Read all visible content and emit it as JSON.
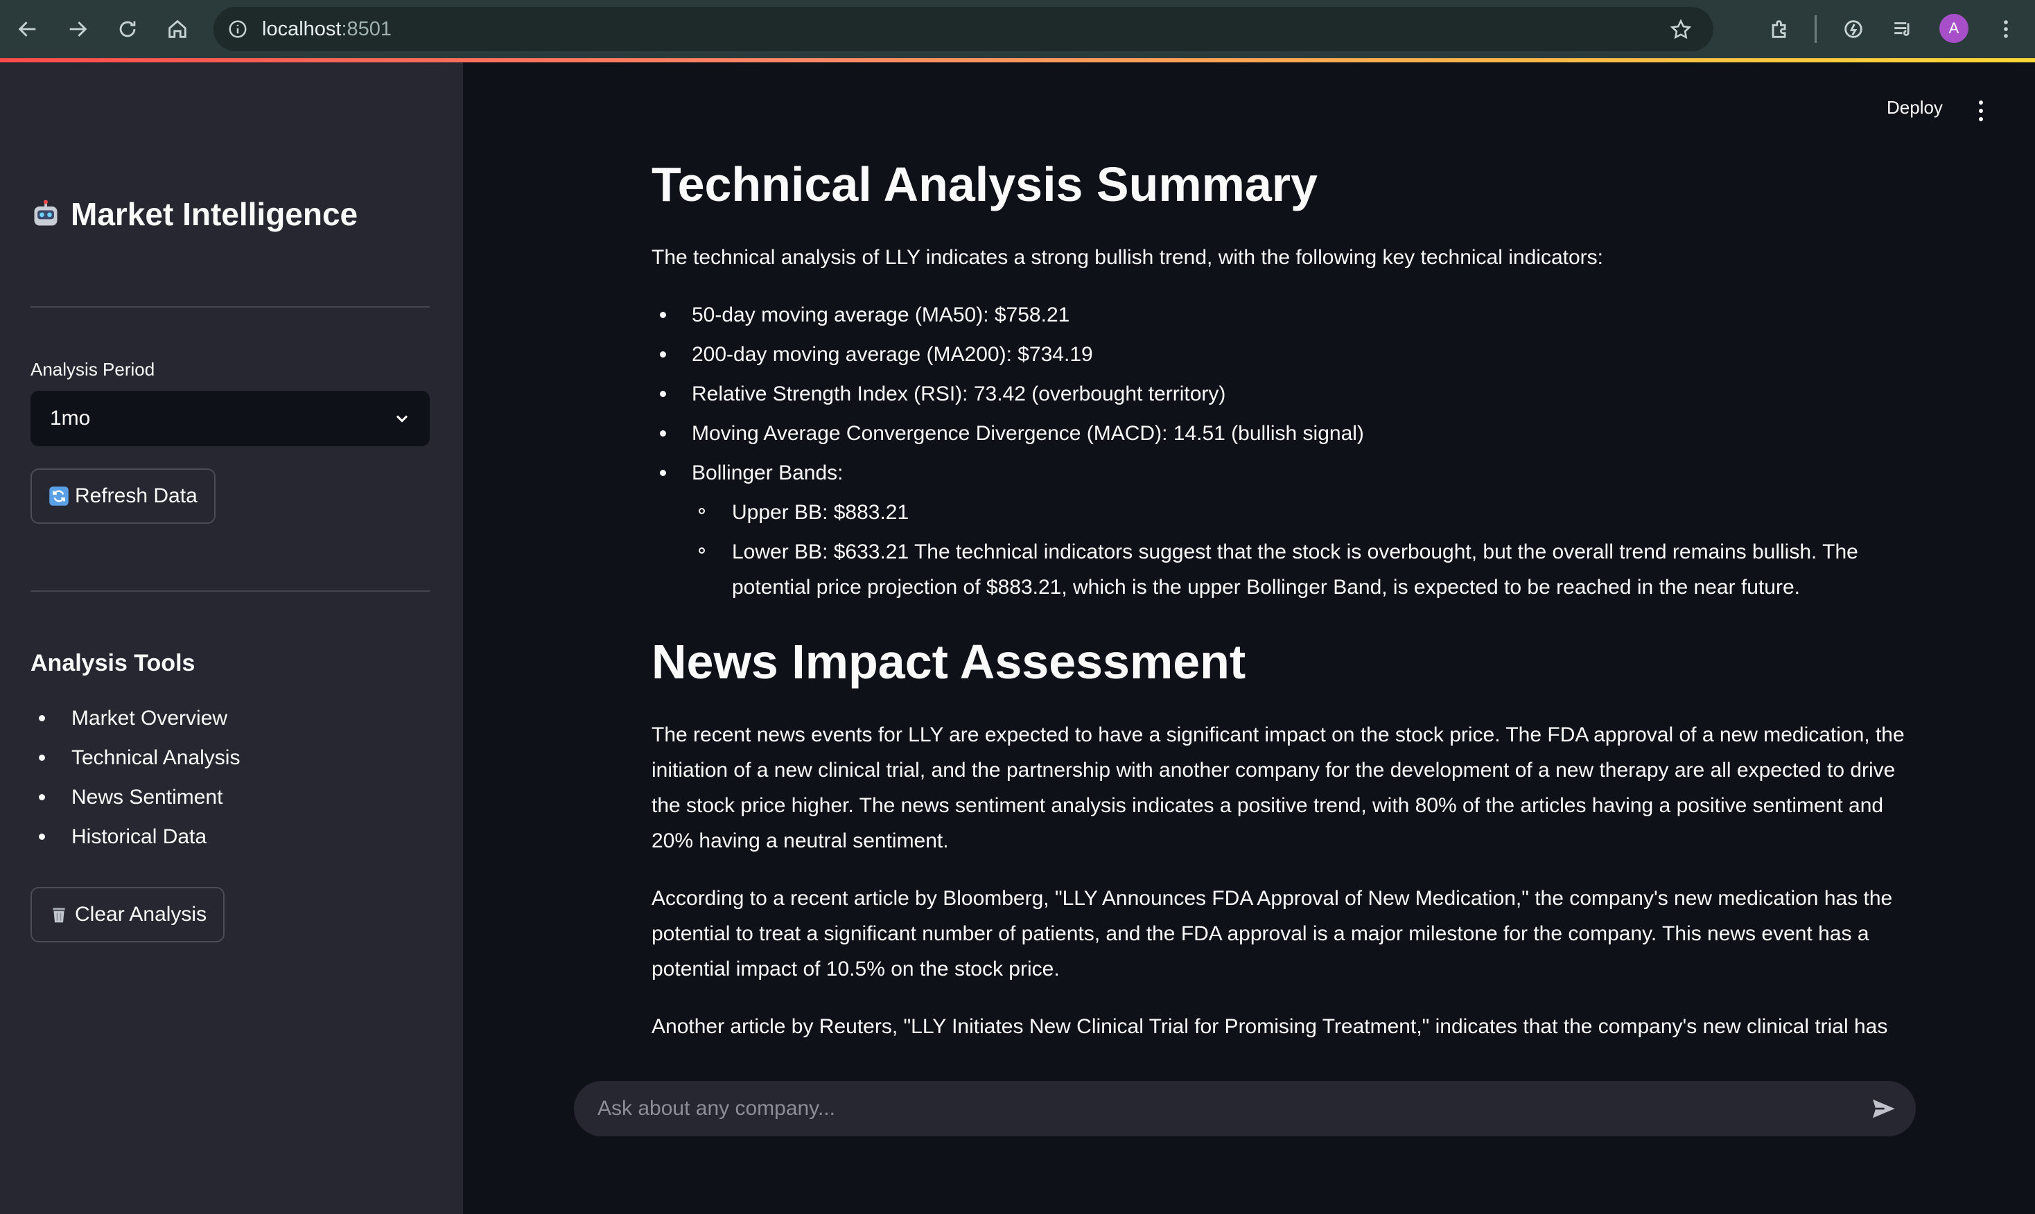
{
  "browser": {
    "url_host": "localhost",
    "url_port": ":8501",
    "avatar_letter": "A"
  },
  "sidebar": {
    "title": "Market Intelligence",
    "period_label": "Analysis Period",
    "period_value": "1mo",
    "refresh_label": "Refresh Data",
    "tools_heading": "Analysis Tools",
    "tools": [
      "Market Overview",
      "Technical Analysis",
      "News Sentiment",
      "Historical Data"
    ],
    "clear_label": "Clear Analysis"
  },
  "header": {
    "deploy_label": "Deploy"
  },
  "main": {
    "technical": {
      "heading": "Technical Analysis Summary",
      "intro": "The technical analysis of LLY indicates a strong bullish trend, with the following key technical indicators:",
      "indicators": [
        "50-day moving average (MA50): $758.21",
        "200-day moving average (MA200): $734.19",
        "Relative Strength Index (RSI): 73.42 (overbought territory)",
        "Moving Average Convergence Divergence (MACD): 14.51 (bullish signal)",
        "Bollinger Bands:"
      ],
      "bollinger": [
        "Upper BB: $883.21",
        "Lower BB: $633.21 The technical indicators suggest that the stock is overbought, but the overall trend remains bullish. The potential price projection of $883.21, which is the upper Bollinger Band, is expected to be reached in the near future."
      ]
    },
    "news": {
      "heading": "News Impact Assessment",
      "paragraphs": [
        "The recent news events for LLY are expected to have a significant impact on the stock price. The FDA approval of a new medication, the initiation of a new clinical trial, and the partnership with another company for the development of a new therapy are all expected to drive the stock price higher. The news sentiment analysis indicates a positive trend, with 80% of the articles having a positive sentiment and 20% having a neutral sentiment.",
        "According to a recent article by Bloomberg, \"LLY Announces FDA Approval of New Medication,\" the company's new medication has the potential to treat a significant number of patients, and the FDA approval is a major milestone for the company. This news event has a potential impact of 10.5% on the stock price.",
        "Another article by Reuters, \"LLY Initiates New Clinical Trial for Promising Treatment,\" indicates that the company's new clinical trial has"
      ]
    }
  },
  "chat": {
    "placeholder": "Ask about any company..."
  }
}
